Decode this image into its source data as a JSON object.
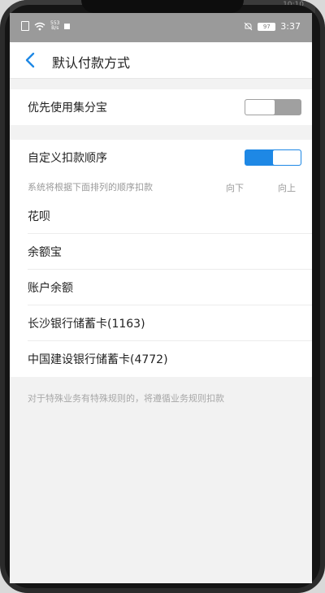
{
  "device": {
    "top_time": "10:10"
  },
  "status_bar": {
    "sim_label": "4G",
    "speed_top": "553",
    "speed_bottom": "B/s",
    "battery": "97",
    "time": "3:37"
  },
  "header": {
    "title": "默认付款方式"
  },
  "settings": {
    "jifenbao_label": "优先使用集分宝",
    "jifenbao_enabled": false,
    "custom_order_label": "自定义扣款顺序",
    "custom_order_enabled": true,
    "order_hint": "系统将根据下面排列的顺序扣款",
    "col_down": "向下",
    "col_up": "向上"
  },
  "payment_methods": [
    {
      "label": "花呗"
    },
    {
      "label": "余额宝"
    },
    {
      "label": "账户余额"
    },
    {
      "label": "长沙银行储蓄卡(1163)"
    },
    {
      "label": "中国建设银行储蓄卡(4772)"
    }
  ],
  "footer_note": "对于特殊业务有特殊规则的，将遵循业务规则扣款",
  "colors": {
    "accent": "#1e88e5",
    "toggle_off": "#a0a0a0",
    "background": "#f2f2f2"
  }
}
